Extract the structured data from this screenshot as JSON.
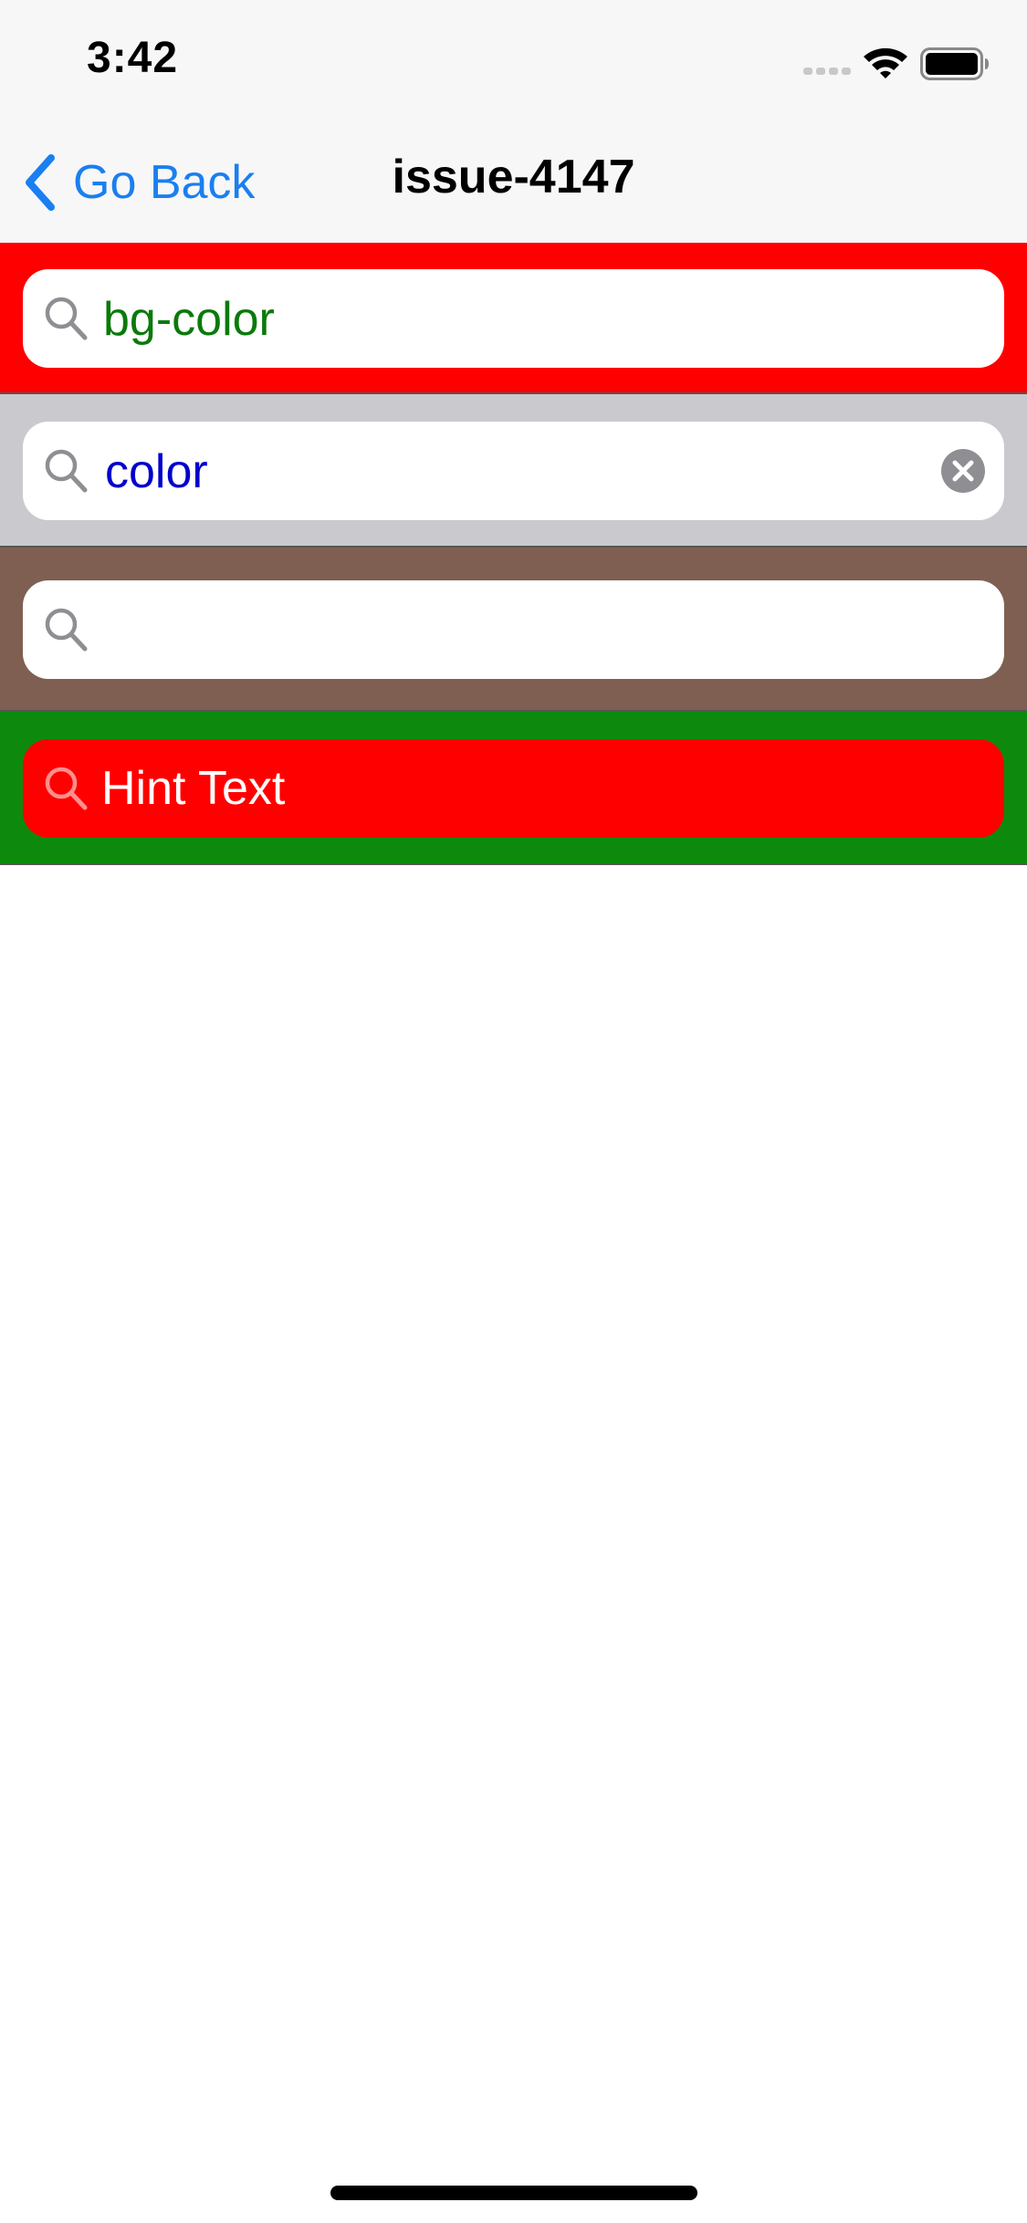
{
  "status_bar": {
    "time": "3:42",
    "icons": [
      "signal-icon",
      "wifi-icon",
      "battery-icon"
    ]
  },
  "nav": {
    "back_label": "Go Back",
    "title": "issue-4147",
    "accent_color": "#1a7ff0"
  },
  "search_bars": [
    {
      "value": "bg-color",
      "placeholder": "",
      "row_color": "#ff0000",
      "field_color": "#ffffff",
      "text_color": "#0a7a0a",
      "has_clear_button": false
    },
    {
      "value": "color",
      "placeholder": "",
      "row_color": "#c9c9ce",
      "field_color": "#ffffff",
      "text_color": "#0000cc",
      "has_clear_button": true
    },
    {
      "value": "",
      "placeholder": "",
      "row_color": "#7f5f52",
      "field_color": "#ffffff",
      "text_color": "#000000",
      "has_clear_button": false
    },
    {
      "value": "",
      "placeholder": "Hint Text",
      "row_color": "#0d8a0d",
      "field_color": "#ff0000",
      "text_color": "#ffffff",
      "has_clear_button": false
    }
  ]
}
